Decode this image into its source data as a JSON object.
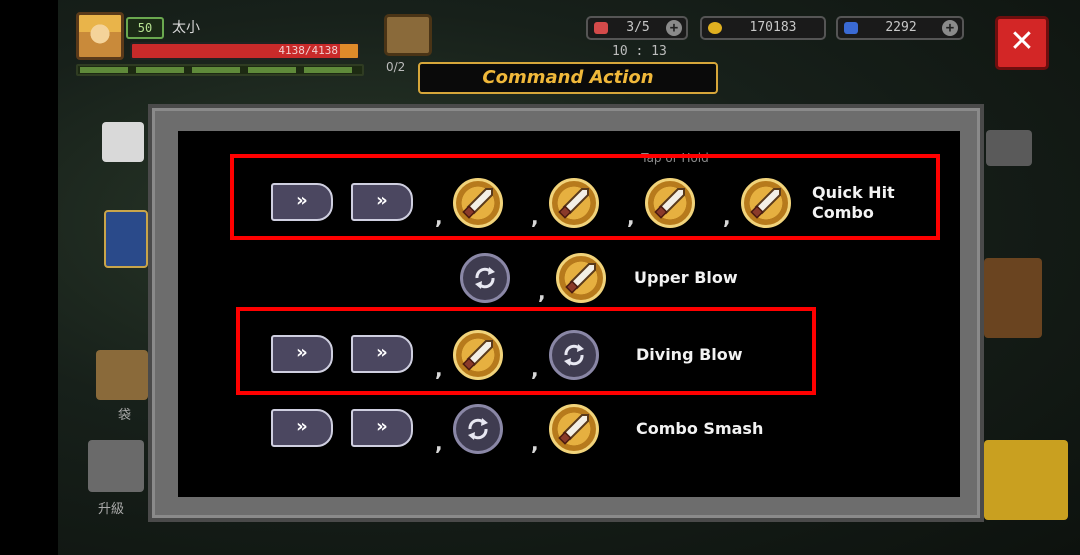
{
  "player": {
    "level": "50",
    "name": "太小",
    "hp_text": "4138/4138",
    "hp_fraction": 1.0
  },
  "inventory": {
    "count_text": "0/2"
  },
  "resources": {
    "hearts": {
      "value": "3/5",
      "icon": "heart-icon",
      "color": "#d44a4a"
    },
    "gold": {
      "value": "170183",
      "icon": "coin-icon",
      "color": "#e0b020"
    },
    "gems": {
      "value": "2292",
      "icon": "gem-icon",
      "color": "#3a6ad4"
    },
    "plus_glyph": "+"
  },
  "timer": "10 : 13",
  "close_glyph": "✕",
  "side": {
    "bag_label": "袋",
    "upgrade_label": "升級"
  },
  "dialog": {
    "title": "Command Action",
    "hint": "Tap or Hold",
    "arrow_glyph": "»",
    "comma": ",",
    "combos": [
      {
        "name": "Quick Hit Combo",
        "sequence": [
          "dash",
          "dash",
          "attack",
          "attack",
          "attack",
          "attack"
        ],
        "highlighted": true
      },
      {
        "name": "Upper Blow",
        "sequence": [
          "jump",
          "attack"
        ],
        "highlighted": false
      },
      {
        "name": "Diving Blow",
        "sequence": [
          "dash",
          "dash",
          "attack",
          "jump"
        ],
        "highlighted": true
      },
      {
        "name": "Combo Smash",
        "sequence": [
          "dash",
          "dash",
          "jump",
          "attack"
        ],
        "highlighted": false
      }
    ]
  },
  "colors": {
    "accent": "#f0b83a",
    "highlight": "#ff0000",
    "close": "#d32626"
  }
}
